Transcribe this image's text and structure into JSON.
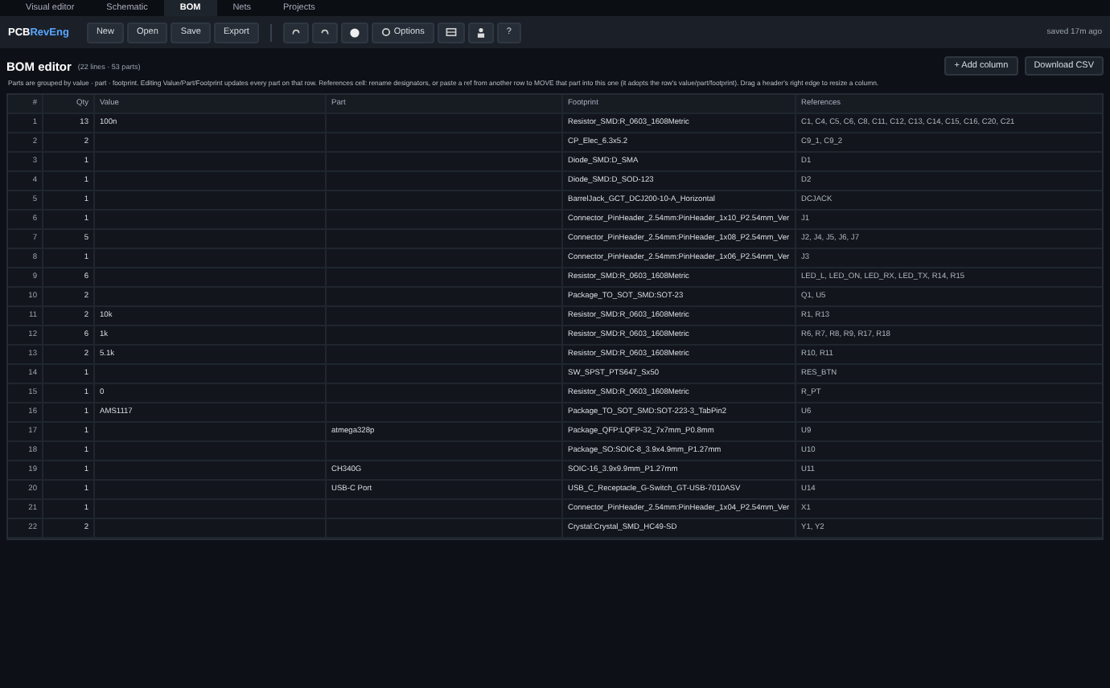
{
  "tabs": [
    {
      "label": "Visual editor",
      "selected": false
    },
    {
      "label": "Schematic",
      "selected": false
    },
    {
      "label": "BOM",
      "selected": true
    },
    {
      "label": "Nets",
      "selected": false
    },
    {
      "label": "Projects",
      "selected": false
    }
  ],
  "logo": {
    "first": "PCB",
    "second": "RevEng"
  },
  "toolbar": [
    {
      "kind": "text",
      "label": "New"
    },
    {
      "kind": "text",
      "label": "Open"
    },
    {
      "kind": "text",
      "label": "Save"
    },
    {
      "kind": "text",
      "label": "Export"
    },
    {
      "kind": "sep"
    },
    {
      "kind": "undo"
    },
    {
      "kind": "redo"
    },
    {
      "kind": "dot"
    },
    {
      "kind": "gear",
      "label": "Options"
    },
    {
      "kind": "panel"
    },
    {
      "kind": "person"
    },
    {
      "kind": "text",
      "label": "?"
    }
  ],
  "status": "saved 17m ago",
  "title": "BOM editor",
  "summary": "(22 lines · 53 parts)",
  "actions": [
    "+ Add column",
    "Download CSV"
  ],
  "help": "Parts are grouped by value · part · footprint. Editing Value/Part/Footprint updates every part on that row. References cell: rename designators, or paste a ref from another row to MOVE that part into this one (it adopts the row's value/part/footprint). Drag a header's right edge to resize a column.",
  "columns": [
    "#",
    "Qty",
    "Value",
    "Part",
    "Footprint",
    "References"
  ],
  "rows": [
    [
      "1",
      "13",
      "100n",
      "",
      "Resistor_SMD:R_0603_1608Metric",
      "C1, C4, C5, C6, C8, C11, C12, C13, C14, C15, C16, C20, C21"
    ],
    [
      "2",
      "2",
      "",
      "",
      "CP_Elec_6.3x5.2",
      "C9_1, C9_2"
    ],
    [
      "3",
      "1",
      "",
      "",
      "Diode_SMD:D_SMA",
      "D1"
    ],
    [
      "4",
      "1",
      "",
      "",
      "Diode_SMD:D_SOD-123",
      "D2"
    ],
    [
      "5",
      "1",
      "",
      "",
      "BarrelJack_GCT_DCJ200-10-A_Horizontal",
      "DCJACK"
    ],
    [
      "6",
      "1",
      "",
      "",
      "Connector_PinHeader_2.54mm:PinHeader_1x10_P2.54mm_Ver",
      "J1"
    ],
    [
      "7",
      "5",
      "",
      "",
      "Connector_PinHeader_2.54mm:PinHeader_1x08_P2.54mm_Ver",
      "J2, J4, J5, J6, J7"
    ],
    [
      "8",
      "1",
      "",
      "",
      "Connector_PinHeader_2.54mm:PinHeader_1x06_P2.54mm_Ver",
      "J3"
    ],
    [
      "9",
      "6",
      "",
      "",
      "Resistor_SMD:R_0603_1608Metric",
      "LED_L, LED_ON, LED_RX, LED_TX, R14, R15"
    ],
    [
      "10",
      "2",
      "",
      "",
      "Package_TO_SOT_SMD:SOT-23",
      "Q1, U5"
    ],
    [
      "11",
      "2",
      "10k",
      "",
      "Resistor_SMD:R_0603_1608Metric",
      "R1, R13"
    ],
    [
      "12",
      "6",
      "1k",
      "",
      "Resistor_SMD:R_0603_1608Metric",
      "R6, R7, R8, R9, R17, R18"
    ],
    [
      "13",
      "2",
      "5.1k",
      "",
      "Resistor_SMD:R_0603_1608Metric",
      "R10, R11"
    ],
    [
      "14",
      "1",
      "",
      "",
      "SW_SPST_PTS647_Sx50",
      "RES_BTN"
    ],
    [
      "15",
      "1",
      "0",
      "",
      "Resistor_SMD:R_0603_1608Metric",
      "R_PT"
    ],
    [
      "16",
      "1",
      "AMS1117",
      "",
      "Package_TO_SOT_SMD:SOT-223-3_TabPin2",
      "U6"
    ],
    [
      "17",
      "1",
      "",
      "atmega328p",
      "Package_QFP:LQFP-32_7x7mm_P0.8mm",
      "U9"
    ],
    [
      "18",
      "1",
      "",
      "",
      "Package_SO:SOIC-8_3.9x4.9mm_P1.27mm",
      "U10"
    ],
    [
      "19",
      "1",
      "",
      "CH340G",
      "SOIC-16_3.9x9.9mm_P1.27mm",
      "U11"
    ],
    [
      "20",
      "1",
      "",
      "USB-C Port",
      "USB_C_Receptacle_G-Switch_GT-USB-7010ASV",
      "U14"
    ],
    [
      "21",
      "1",
      "",
      "",
      "Connector_PinHeader_2.54mm:PinHeader_1x04_P2.54mm_Ver",
      "X1"
    ],
    [
      "22",
      "2",
      "",
      "",
      "Crystal:Crystal_SMD_HC49-SD",
      "Y1, Y2"
    ]
  ]
}
